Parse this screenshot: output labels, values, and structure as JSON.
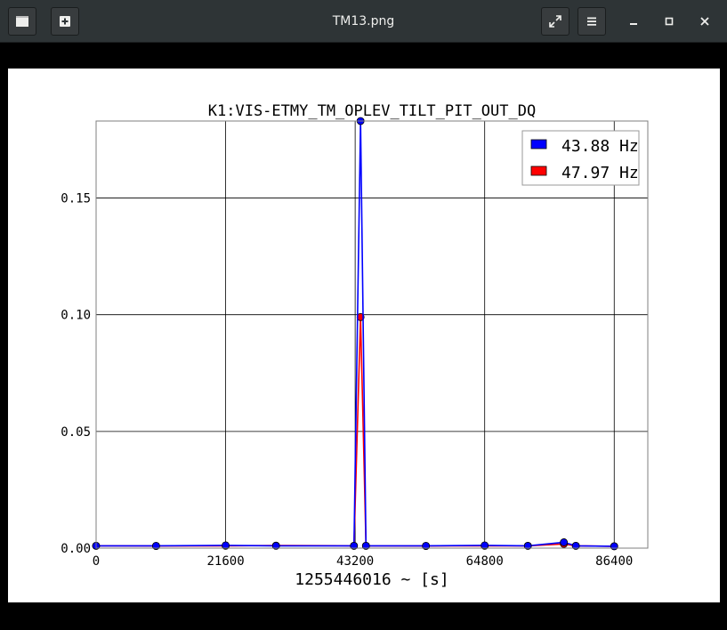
{
  "window": {
    "title": "TM13.png",
    "controls": {
      "view_icon": "sidebar-icon",
      "new_icon": "new-window-icon",
      "fullscreen_icon": "fullscreen-icon",
      "menu_icon": "hamburger-menu-icon",
      "minimize_icon": "minimize-icon",
      "maximize_icon": "maximize-icon",
      "close_icon": "close-icon"
    }
  },
  "colors": {
    "titlebar": "#2e3436",
    "series1": "#0000ff",
    "series2": "#ff0000",
    "grid": "#000000"
  },
  "chart_data": {
    "type": "line",
    "title": "K1:VIS-ETMY_TM_OPLEV_TILT_PIT_OUT_DQ",
    "xlabel": "1255446016 ~ [s]",
    "ylabel": "",
    "xlim": [
      0,
      92000
    ],
    "ylim": [
      0,
      0.183
    ],
    "xticks": [
      0,
      21600,
      43200,
      64800,
      86400
    ],
    "xtick_labels": [
      "0",
      "21600",
      "43200",
      "64800",
      "86400"
    ],
    "yticks": [
      0.0,
      0.05,
      0.1,
      0.15
    ],
    "ytick_labels": [
      "0.00",
      "0.05",
      "0.10",
      "0.15"
    ],
    "grid": true,
    "legend_position": "top-right",
    "series": [
      {
        "name": "43.88 Hz",
        "marker": "circle",
        "color": "#0000ff",
        "points": [
          {
            "x": 0,
            "y": 0.001
          },
          {
            "x": 10000,
            "y": 0.001
          },
          {
            "x": 21600,
            "y": 0.0012
          },
          {
            "x": 30000,
            "y": 0.001
          },
          {
            "x": 43000,
            "y": 0.001
          },
          {
            "x": 44100,
            "y": 0.183
          },
          {
            "x": 45000,
            "y": 0.001
          },
          {
            "x": 55000,
            "y": 0.001
          },
          {
            "x": 64800,
            "y": 0.0012
          },
          {
            "x": 72000,
            "y": 0.001
          },
          {
            "x": 78000,
            "y": 0.0025
          },
          {
            "x": 80000,
            "y": 0.001
          },
          {
            "x": 86400,
            "y": 0.0008
          }
        ]
      },
      {
        "name": "47.97 Hz",
        "marker": "circle",
        "color": "#ff0000",
        "points": [
          {
            "x": 0,
            "y": 0.001
          },
          {
            "x": 10000,
            "y": 0.0009
          },
          {
            "x": 21600,
            "y": 0.001
          },
          {
            "x": 30000,
            "y": 0.0011
          },
          {
            "x": 43000,
            "y": 0.001
          },
          {
            "x": 44100,
            "y": 0.099
          },
          {
            "x": 45000,
            "y": 0.001
          },
          {
            "x": 55000,
            "y": 0.0009
          },
          {
            "x": 64800,
            "y": 0.001
          },
          {
            "x": 72000,
            "y": 0.001
          },
          {
            "x": 78000,
            "y": 0.0018
          },
          {
            "x": 80000,
            "y": 0.001
          },
          {
            "x": 86400,
            "y": 0.0008
          }
        ]
      }
    ]
  }
}
